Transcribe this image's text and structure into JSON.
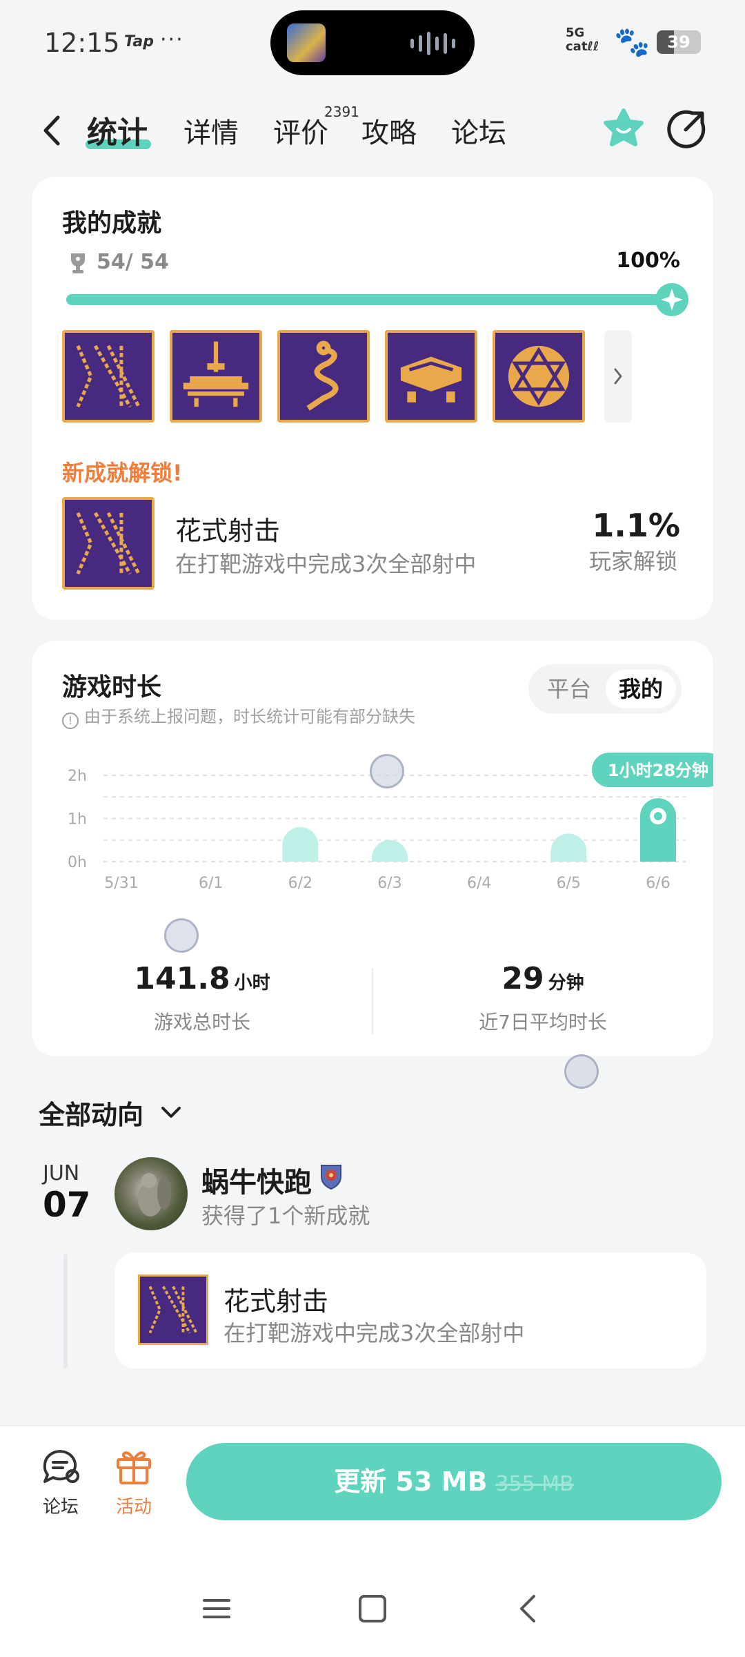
{
  "status_bar": {
    "time": "12:15",
    "tap_label": "Tap",
    "dots": "···",
    "signal": "5G",
    "carrier": "catℓℓ",
    "battery": "39",
    "battery_level": 0.39
  },
  "nav": {
    "tabs": [
      {
        "label": "统计",
        "active": true
      },
      {
        "label": "详情",
        "active": false
      },
      {
        "label": "评价",
        "active": false,
        "badge": "2391"
      },
      {
        "label": "攻略",
        "active": false
      },
      {
        "label": "论坛",
        "active": false
      }
    ],
    "icons": {
      "back": "back-arrow-icon",
      "favorite": "star-icon",
      "share": "share-icon"
    }
  },
  "achievements": {
    "title": "我的成就",
    "count": "54/ 54",
    "percent": "100%",
    "progress": 1.0,
    "new_label": "新成就解锁!",
    "new_item": {
      "name": "花式射击",
      "desc": "在打靶游戏中完成3次全部射中",
      "percent": "1.1%",
      "percent_label": "玩家解锁"
    },
    "colors": {
      "accent": "#5ed4bf",
      "badge_bg": "#47297f",
      "badge_fg": "#e9a84a",
      "new_label": "#ef7e3c"
    }
  },
  "playtime": {
    "title": "游戏时长",
    "note": "由于系统上报问题，时长统计可能有部分缺失",
    "segments": [
      "平台",
      "我的"
    ],
    "selected_segment": "我的",
    "stats": [
      {
        "value": "141.8",
        "unit": "小时",
        "label": "游戏总时长"
      },
      {
        "value": "29",
        "unit": "分钟",
        "label": "近7日平均时长"
      }
    ]
  },
  "chart_data": {
    "type": "bar",
    "categories": [
      "5/31",
      "6/1",
      "6/2",
      "6/3",
      "6/4",
      "6/5",
      "6/6"
    ],
    "values": [
      0,
      0,
      0.8,
      0.5,
      0,
      0.65,
      1.47
    ],
    "y_ticks": [
      "0h",
      "1h",
      "2h"
    ],
    "ylim": [
      0,
      2
    ],
    "highlight_index": 6,
    "highlight_label": "1小时28分钟",
    "grid": true,
    "colors": {
      "bar": "#bff0e7",
      "highlight": "#5ed4bf"
    }
  },
  "feed": {
    "title": "全部动向",
    "entries": [
      {
        "month": "JUN",
        "day": "07",
        "user": "蜗牛快跑",
        "action": "获得了1个新成就",
        "item": {
          "name": "花式射击",
          "desc": "在打靶游戏中完成3次全部射中"
        }
      }
    ]
  },
  "bottom": {
    "forum_label": "论坛",
    "event_label": "活动",
    "update_label": "更新 53 MB",
    "update_old": "355 MB"
  }
}
